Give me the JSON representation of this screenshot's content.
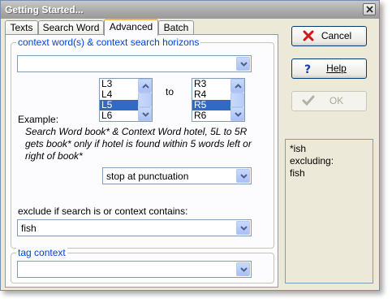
{
  "window": {
    "title": "Getting Started..."
  },
  "tabs": [
    {
      "label": "Texts",
      "active": false
    },
    {
      "label": "Search Word",
      "active": false
    },
    {
      "label": "Advanced",
      "active": true
    },
    {
      "label": "Batch",
      "active": false
    }
  ],
  "context": {
    "group_title": "context word(s) & context search horizons",
    "word_value": "",
    "left_list": [
      {
        "label": "L3",
        "selected": false
      },
      {
        "label": "L4",
        "selected": false
      },
      {
        "label": "L5",
        "selected": true
      },
      {
        "label": "L6",
        "selected": false
      }
    ],
    "to_label": "to",
    "right_list": [
      {
        "label": "R3",
        "selected": false
      },
      {
        "label": "R4",
        "selected": false
      },
      {
        "label": "R5",
        "selected": true
      },
      {
        "label": "R6",
        "selected": false
      }
    ],
    "example_label": "Example:",
    "example_text": "Search Word book* & Context Word hotel, 5L to 5R gets book* only if hotel is found within 5 words left or right of book*",
    "stop_value": "stop at punctuation",
    "exclude_label": "exclude if search is or context contains:",
    "exclude_value": "fish"
  },
  "tag_context": {
    "group_title": "tag context",
    "value": ""
  },
  "buttons": {
    "cancel": "Cancel",
    "help": "Help",
    "ok": "OK"
  },
  "preview": {
    "lines": [
      "*ish",
      "excluding:",
      "fish"
    ]
  }
}
